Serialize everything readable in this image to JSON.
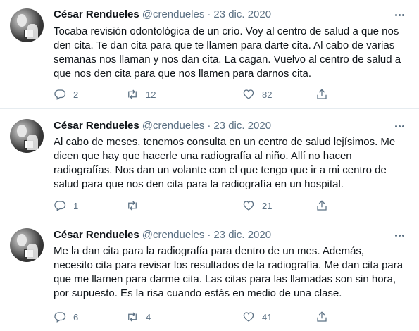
{
  "tweets": [
    {
      "author_name": "César Rendueles",
      "handle": "@crendueles",
      "separator": "·",
      "date": "23 dic. 2020",
      "text": "Tocaba revisión odontológica de un crío. Voy al centro de salud a que nos den cita. Te dan cita para que te llamen para darte cita. Al cabo de varias semanas nos llaman y nos dan cita. La cagan. Vuelvo al centro de salud a que nos den cita para que nos llamen para darnos cita.",
      "replies": "2",
      "retweets": "12",
      "likes": "82"
    },
    {
      "author_name": "César Rendueles",
      "handle": "@crendueles",
      "separator": "·",
      "date": "23 dic. 2020",
      "text": "Al cabo de meses, tenemos consulta en un centro de salud lejísimos. Me dicen que hay que hacerle una radiografía al niño. Allí no hacen radiografías. Nos dan un volante con el que tengo que ir a mi centro de salud para que nos den cita para la radiografía en un hospital.",
      "replies": "1",
      "retweets": "",
      "likes": "21"
    },
    {
      "author_name": "César Rendueles",
      "handle": "@crendueles",
      "separator": "·",
      "date": "23 dic. 2020",
      "text": "Me la dan cita para la radiografía para dentro de un mes. Además, necesito cita para revisar los resultados de la radiografía. Me dan cita para que me llamen para darme cita. Las citas para las llamadas son sin hora, por supuesto. Es la risa cuando estás en medio de una clase.",
      "replies": "6",
      "retweets": "4",
      "likes": "41"
    }
  ],
  "icons": {
    "reply": "reply-icon",
    "retweet": "retweet-icon",
    "like": "heart-icon",
    "share": "share-icon",
    "more": "more-icon"
  },
  "colors": {
    "secondary_text": "#5b7083",
    "divider": "#e6ecf0"
  }
}
